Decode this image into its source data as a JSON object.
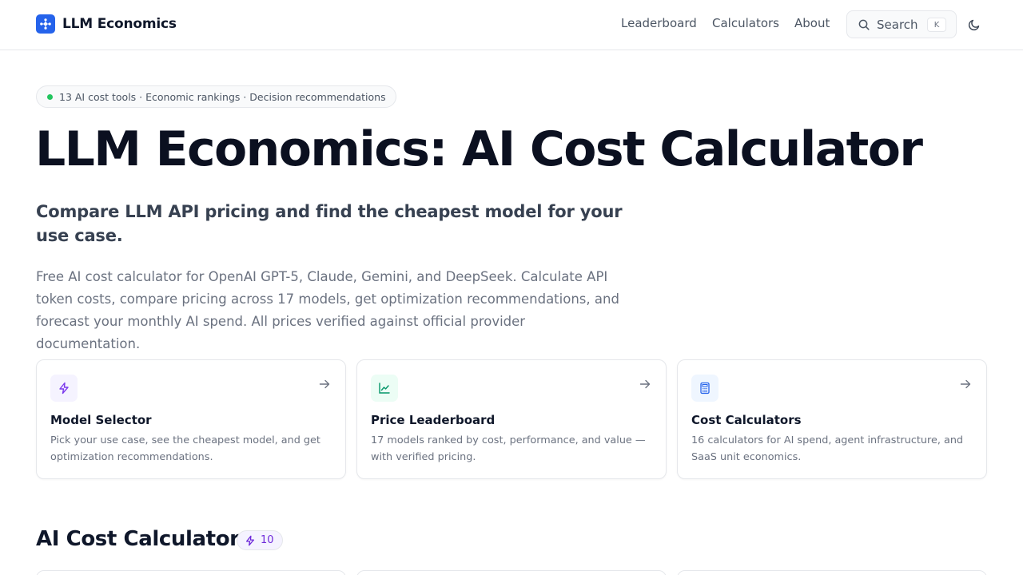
{
  "header": {
    "logo_text": "LLM Economics",
    "nav": [
      {
        "label": "Leaderboard"
      },
      {
        "label": "Calculators"
      },
      {
        "label": "About"
      }
    ],
    "search": {
      "label": "Search",
      "shortcut": "K"
    },
    "theme_icon": "moon-icon"
  },
  "hero": {
    "pill": "13 AI cost tools · Economic rankings · Decision recommendations",
    "title": "LLM Economics: AI Cost Calculator",
    "subtitle": "Compare LLM API pricing and find the cheapest model for your use case.",
    "description": "Free AI cost calculator for OpenAI GPT-5, Claude, Gemini, and DeepSeek. Calculate API token costs, compare pricing across 17 models, get optimization recommendations, and forecast your monthly AI spend. All prices verified against official provider documentation."
  },
  "cards": [
    {
      "title": "Model Selector",
      "description": "Pick your use case, see the cheapest model, and get optimization recommendations.",
      "icon": "lightning-icon",
      "color": "#7c3aed"
    },
    {
      "title": "Price Leaderboard",
      "description": "17 models ranked by cost, performance, and value — with verified pricing.",
      "icon": "chart-icon",
      "color": "#059669"
    },
    {
      "title": "Cost Calculators",
      "description": "16 calculators for AI spend, agent infrastructure, and SaaS unit economics.",
      "icon": "calculator-icon",
      "color": "#2563eb"
    }
  ],
  "section": {
    "title": "AI Cost Calculators",
    "count": "10"
  },
  "colors": {
    "brand": "#2563eb",
    "status_dot": "#22c55e"
  }
}
